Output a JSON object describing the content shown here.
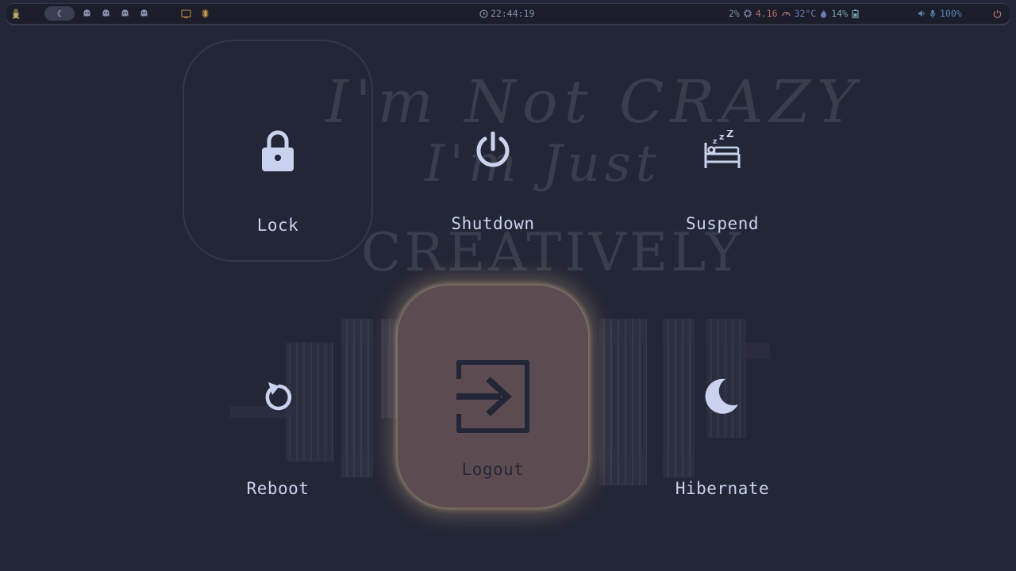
{
  "topbar": {
    "clock": "22:44:19",
    "cpu": "2%",
    "load": "4.16",
    "temp": "32°C",
    "brightness": "14%",
    "volume": "100%"
  },
  "background": {
    "line1": "I'm Not CRAZY",
    "line2": "I'm Just",
    "line3": "CREATIVELY"
  },
  "menu": {
    "lock": "Lock",
    "shutdown": "Shutdown",
    "suspend": "Suspend",
    "reboot": "Reboot",
    "logout": "Logout",
    "hibernate": "Hibernate"
  },
  "colors": {
    "background": "#232636",
    "accent_selected": "#5c4c52",
    "glow": "#e6be8c",
    "icon": "#c9d3f0"
  },
  "icons": [
    "tux-icon",
    "moon-icon",
    "ghost-icon",
    "monitor-icon",
    "bluetooth-icon",
    "clock-icon",
    "chip-icon",
    "gauge-icon",
    "flame-icon",
    "battery-icon",
    "speaker-icon",
    "mic-icon",
    "power-icon",
    "lock-icon",
    "shutdown-icon",
    "bed-icon",
    "reboot-icon",
    "logout-icon",
    "hibernate-icon"
  ]
}
